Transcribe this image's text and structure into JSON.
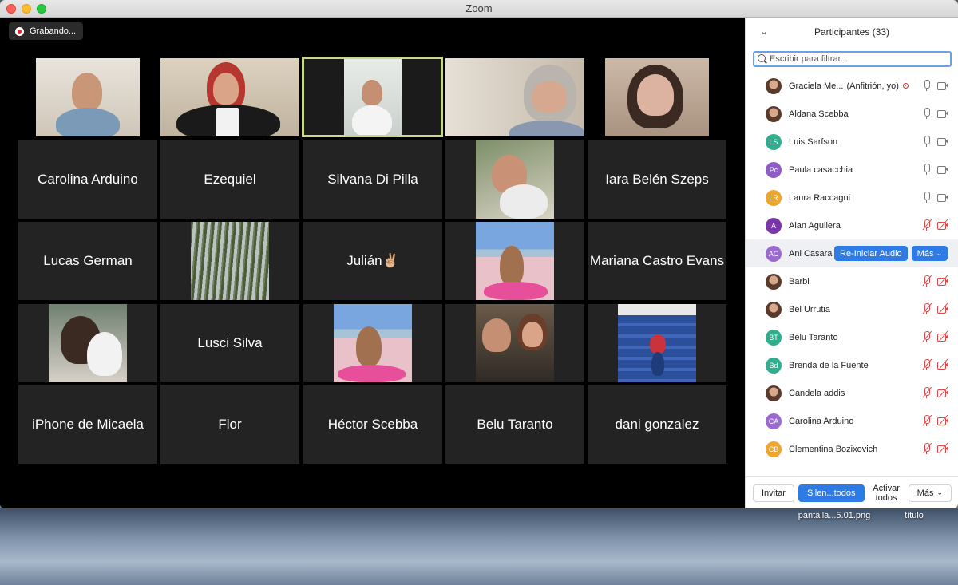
{
  "window": {
    "title": "Zoom"
  },
  "recording": {
    "label": "Grabando..."
  },
  "tiles": {
    "r1": [
      "",
      "",
      "",
      "",
      ""
    ],
    "r2": [
      "Carolina Arduino",
      "Ezequiel",
      "Silvana Di Pilla",
      "",
      "Iara Belén Szeps"
    ],
    "r3": [
      "Lucas German",
      "",
      "Julián✌🏼",
      "",
      "Mariana Castro Evans"
    ],
    "r4": [
      "",
      "Lusci Silva",
      "",
      "",
      ""
    ],
    "r5": [
      "iPhone de Micaela",
      "Flor",
      "Héctor Scebba",
      "Belu Taranto",
      "dani gonzalez"
    ]
  },
  "panel": {
    "title": "Participantes (33)",
    "filter_placeholder": "Escribir para filtrar...",
    "participants": [
      {
        "name": "Graciela Me...",
        "tag": "(Anfitrión, yo)",
        "initials": "",
        "color": "",
        "audio": "on",
        "video": "on"
      },
      {
        "name": "Aldana Scebba",
        "initials": "",
        "color": "",
        "audio": "on",
        "video": "on"
      },
      {
        "name": "Luis Sarfson",
        "initials": "LS",
        "color": "#2fae8f",
        "audio": "on",
        "video": "on"
      },
      {
        "name": "Paula casacchia",
        "initials": "Pc",
        "color": "#8e5cc6",
        "audio": "on",
        "video": "on"
      },
      {
        "name": "Laura Raccagni",
        "initials": "LR",
        "color": "#f0a530",
        "audio": "on",
        "video": "on"
      },
      {
        "name": "Alan Aguilera",
        "initials": "A",
        "color": "#7a35a8",
        "audio": "off",
        "video": "off"
      },
      {
        "name": "Ani Casara",
        "initials": "AC",
        "color": "#9a6ad0",
        "audio": "",
        "video": ""
      },
      {
        "name": "Barbi",
        "initials": "",
        "color": "",
        "audio": "off",
        "video": "off"
      },
      {
        "name": "Bel Urrutia",
        "initials": "",
        "color": "",
        "audio": "off",
        "video": "off"
      },
      {
        "name": "Belu Taranto",
        "initials": "BT",
        "color": "#2fae8f",
        "audio": "off",
        "video": "off"
      },
      {
        "name": "Brenda de la Fuente",
        "initials": "Bd",
        "color": "#2fae8f",
        "audio": "off",
        "video": "off"
      },
      {
        "name": "Candela addis",
        "initials": "",
        "color": "",
        "audio": "off",
        "video": "off"
      },
      {
        "name": "Carolina Arduino",
        "initials": "CA",
        "color": "#9a6ad0",
        "audio": "off",
        "video": "off"
      },
      {
        "name": "Clementina Bozixovich",
        "initials": "CB",
        "color": "#f0a530",
        "audio": "off",
        "video": "off"
      }
    ],
    "row_actions": {
      "reiniciar": "Re-Iniciar Audio",
      "mas": "Más"
    },
    "footer": {
      "invitar": "Invitar",
      "silenciar": "Silen...todos",
      "activar": "Activar todos",
      "mas": "Más"
    }
  },
  "desktop": {
    "file1": "pantalla...5.01.png",
    "file2": "título"
  }
}
